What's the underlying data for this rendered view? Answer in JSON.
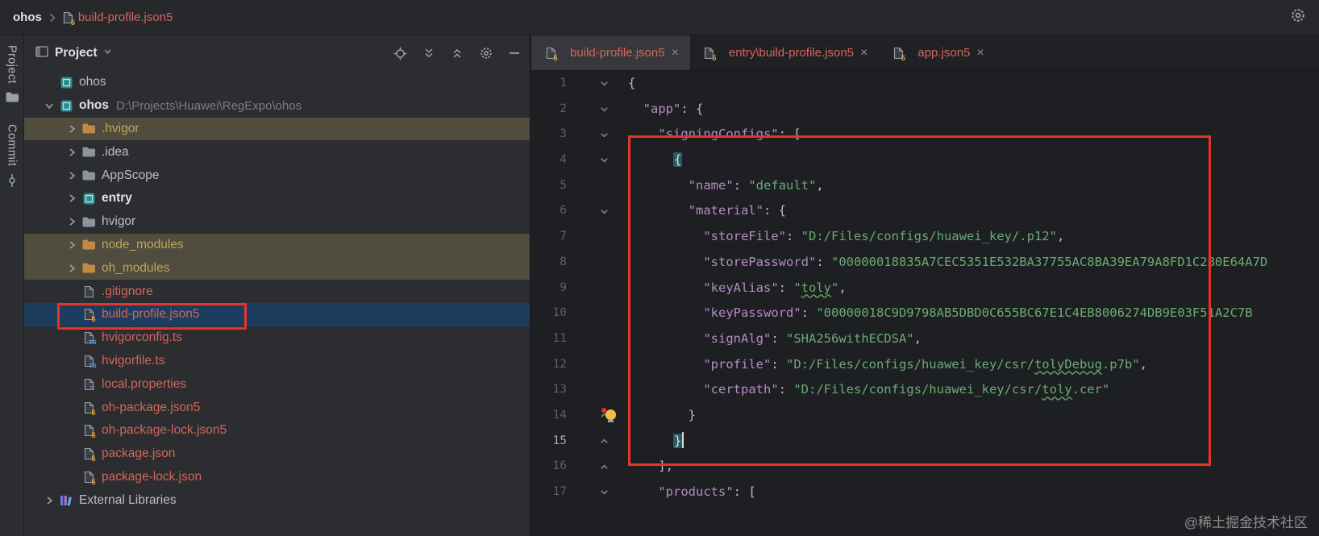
{
  "colors": {
    "annotation_red": "#e8322a",
    "unversioned_file_text": "#d1675a",
    "excluded_row_bg": "#504c3e",
    "selection_bg": "#1d3d5f",
    "json_key": "#b58cc4",
    "json_string": "#6aab73"
  },
  "top_bar": {
    "breadcrumb_project": "ohos",
    "breadcrumb_file": "build-profile.json5",
    "actions": [
      "settings"
    ]
  },
  "tool_stripe": {
    "items": [
      {
        "label": "Project",
        "icon": "folder"
      },
      {
        "label": "Commit",
        "icon": "commit"
      }
    ]
  },
  "project_panel": {
    "title": "Project",
    "header_icons": [
      "locate",
      "expand-all",
      "collapse-all",
      "settings",
      "hide"
    ],
    "tree": [
      {
        "label": "ohos",
        "indent": 0,
        "chevron": "",
        "icon": "module"
      },
      {
        "label": "ohos",
        "path": "D:\\Projects\\Huawei\\RegExpo\\ohos",
        "indent": 0,
        "chevron": "down",
        "icon": "module",
        "bold": true
      },
      {
        "label": ".hvigor",
        "indent": 1,
        "chevron": "right",
        "icon": "folder-ex",
        "row": "excluded",
        "text": "olive"
      },
      {
        "label": ".idea",
        "indent": 1,
        "chevron": "right",
        "icon": "folder"
      },
      {
        "label": "AppScope",
        "indent": 1,
        "chevron": "right",
        "icon": "folder"
      },
      {
        "label": "entry",
        "indent": 1,
        "chevron": "right",
        "icon": "module",
        "bold": true
      },
      {
        "label": "hvigor",
        "indent": 1,
        "chevron": "right",
        "icon": "folder"
      },
      {
        "label": "node_modules",
        "indent": 1,
        "chevron": "right",
        "icon": "folder-ex",
        "row": "excluded",
        "text": "olive"
      },
      {
        "label": "oh_modules",
        "indent": 1,
        "chevron": "right",
        "icon": "folder-ex",
        "row": "excluded",
        "text": "olive"
      },
      {
        "label": ".gitignore",
        "indent": 1,
        "chevron": "",
        "icon": "file",
        "text": "red"
      },
      {
        "label": "build-profile.json5",
        "indent": 1,
        "chevron": "",
        "icon": "json5",
        "text": "red",
        "row": "selected"
      },
      {
        "label": "hvigorconfig.ts",
        "indent": 1,
        "chevron": "",
        "icon": "ts",
        "text": "red"
      },
      {
        "label": "hvigorfile.ts",
        "indent": 1,
        "chevron": "",
        "icon": "ts",
        "text": "red"
      },
      {
        "label": "local.properties",
        "indent": 1,
        "chevron": "",
        "icon": "props",
        "text": "red"
      },
      {
        "label": "oh-package.json5",
        "indent": 1,
        "chevron": "",
        "icon": "json5",
        "text": "red"
      },
      {
        "label": "oh-package-lock.json5",
        "indent": 1,
        "chevron": "",
        "icon": "json5",
        "text": "red"
      },
      {
        "label": "package.json",
        "indent": 1,
        "chevron": "",
        "icon": "json5",
        "text": "red"
      },
      {
        "label": "package-lock.json",
        "indent": 1,
        "chevron": "",
        "icon": "json5",
        "text": "red"
      },
      {
        "label": "External Libraries",
        "indent": 0,
        "chevron": "right",
        "icon": "libs"
      }
    ]
  },
  "editor": {
    "tabs": [
      {
        "label": "build-profile.json5",
        "active": true
      },
      {
        "label": "entry\\build-profile.json5",
        "active": false
      },
      {
        "label": "app.json5",
        "active": false
      }
    ],
    "lines": [
      {
        "n": 1,
        "fold": "down",
        "tokens": [
          [
            "p",
            "{"
          ]
        ]
      },
      {
        "n": 2,
        "fold": "down",
        "tokens": [
          [
            "p",
            "  "
          ],
          [
            "k",
            "\"app\""
          ],
          [
            "p",
            ": {"
          ]
        ]
      },
      {
        "n": 3,
        "fold": "down",
        "tokens": [
          [
            "p",
            "    "
          ],
          [
            "k",
            "\"signingConfigs\""
          ],
          [
            "p",
            ": ["
          ]
        ]
      },
      {
        "n": 4,
        "fold": "down",
        "tokens": [
          [
            "p",
            "      "
          ],
          [
            "m",
            "{"
          ]
        ]
      },
      {
        "n": 5,
        "fold": "",
        "tokens": [
          [
            "p",
            "        "
          ],
          [
            "k",
            "\"name\""
          ],
          [
            "p",
            ": "
          ],
          [
            "s",
            "\"default\""
          ],
          [
            "p",
            ","
          ]
        ]
      },
      {
        "n": 6,
        "fold": "down",
        "tokens": [
          [
            "p",
            "        "
          ],
          [
            "k",
            "\"material\""
          ],
          [
            "p",
            ": {"
          ]
        ]
      },
      {
        "n": 7,
        "fold": "",
        "tokens": [
          [
            "p",
            "          "
          ],
          [
            "k",
            "\"storeFile\""
          ],
          [
            "p",
            ": "
          ],
          [
            "s",
            "\"D:/Files/configs/huawei_key/.p12\""
          ],
          [
            "p",
            ","
          ]
        ]
      },
      {
        "n": 8,
        "fold": "",
        "tokens": [
          [
            "p",
            "          "
          ],
          [
            "k",
            "\"storePassword\""
          ],
          [
            "p",
            ": "
          ],
          [
            "s",
            "\"00000018835A7CEC5351E532BA37755AC8BA39EA79A8FD1C2B0E64A7D"
          ]
        ]
      },
      {
        "n": 9,
        "fold": "",
        "tokens": [
          [
            "p",
            "          "
          ],
          [
            "k",
            "\"keyAlias\""
          ],
          [
            "p",
            ": "
          ],
          [
            "s",
            "\""
          ],
          [
            "sq",
            "toly"
          ],
          [
            "s",
            "\""
          ],
          [
            "p",
            ","
          ]
        ]
      },
      {
        "n": 10,
        "fold": "",
        "tokens": [
          [
            "p",
            "          "
          ],
          [
            "k",
            "\"keyPassword\""
          ],
          [
            "p",
            ": "
          ],
          [
            "s",
            "\"00000018C9D9798AB5DBD0C655BC67E1C4EB8006274DB9E03F51A2C7B"
          ]
        ]
      },
      {
        "n": 11,
        "fold": "",
        "tokens": [
          [
            "p",
            "          "
          ],
          [
            "k",
            "\"signAlg\""
          ],
          [
            "p",
            ": "
          ],
          [
            "s",
            "\"SHA256withECDSA\""
          ],
          [
            "p",
            ","
          ]
        ]
      },
      {
        "n": 12,
        "fold": "",
        "tokens": [
          [
            "p",
            "          "
          ],
          [
            "k",
            "\"profile\""
          ],
          [
            "p",
            ": "
          ],
          [
            "s",
            "\"D:/Files/configs/huawei_key/csr/"
          ],
          [
            "sq",
            "tolyDebug"
          ],
          [
            "s",
            ".p7b\""
          ],
          [
            "p",
            ","
          ]
        ]
      },
      {
        "n": 13,
        "fold": "",
        "tokens": [
          [
            "p",
            "          "
          ],
          [
            "k",
            "\"certpath\""
          ],
          [
            "p",
            ": "
          ],
          [
            "s",
            "\"D:/Files/configs/huawei_key/csr/"
          ],
          [
            "sq",
            "toly"
          ],
          [
            "s",
            ".cer\""
          ]
        ]
      },
      {
        "n": 14,
        "fold": "up",
        "bulb": true,
        "tokens": [
          [
            "p",
            "        }"
          ]
        ]
      },
      {
        "n": 15,
        "fold": "up",
        "caret": true,
        "tokens": [
          [
            "p",
            "      "
          ],
          [
            "m",
            "}"
          ],
          [
            "cursor",
            ""
          ]
        ]
      },
      {
        "n": 16,
        "fold": "up",
        "tokens": [
          [
            "p",
            "    ],"
          ]
        ]
      },
      {
        "n": 17,
        "fold": "down",
        "tokens": [
          [
            "p",
            "    "
          ],
          [
            "k",
            "\"products\""
          ],
          [
            "p",
            ": ["
          ]
        ]
      }
    ]
  },
  "watermark": "@稀土掘金技术社区"
}
